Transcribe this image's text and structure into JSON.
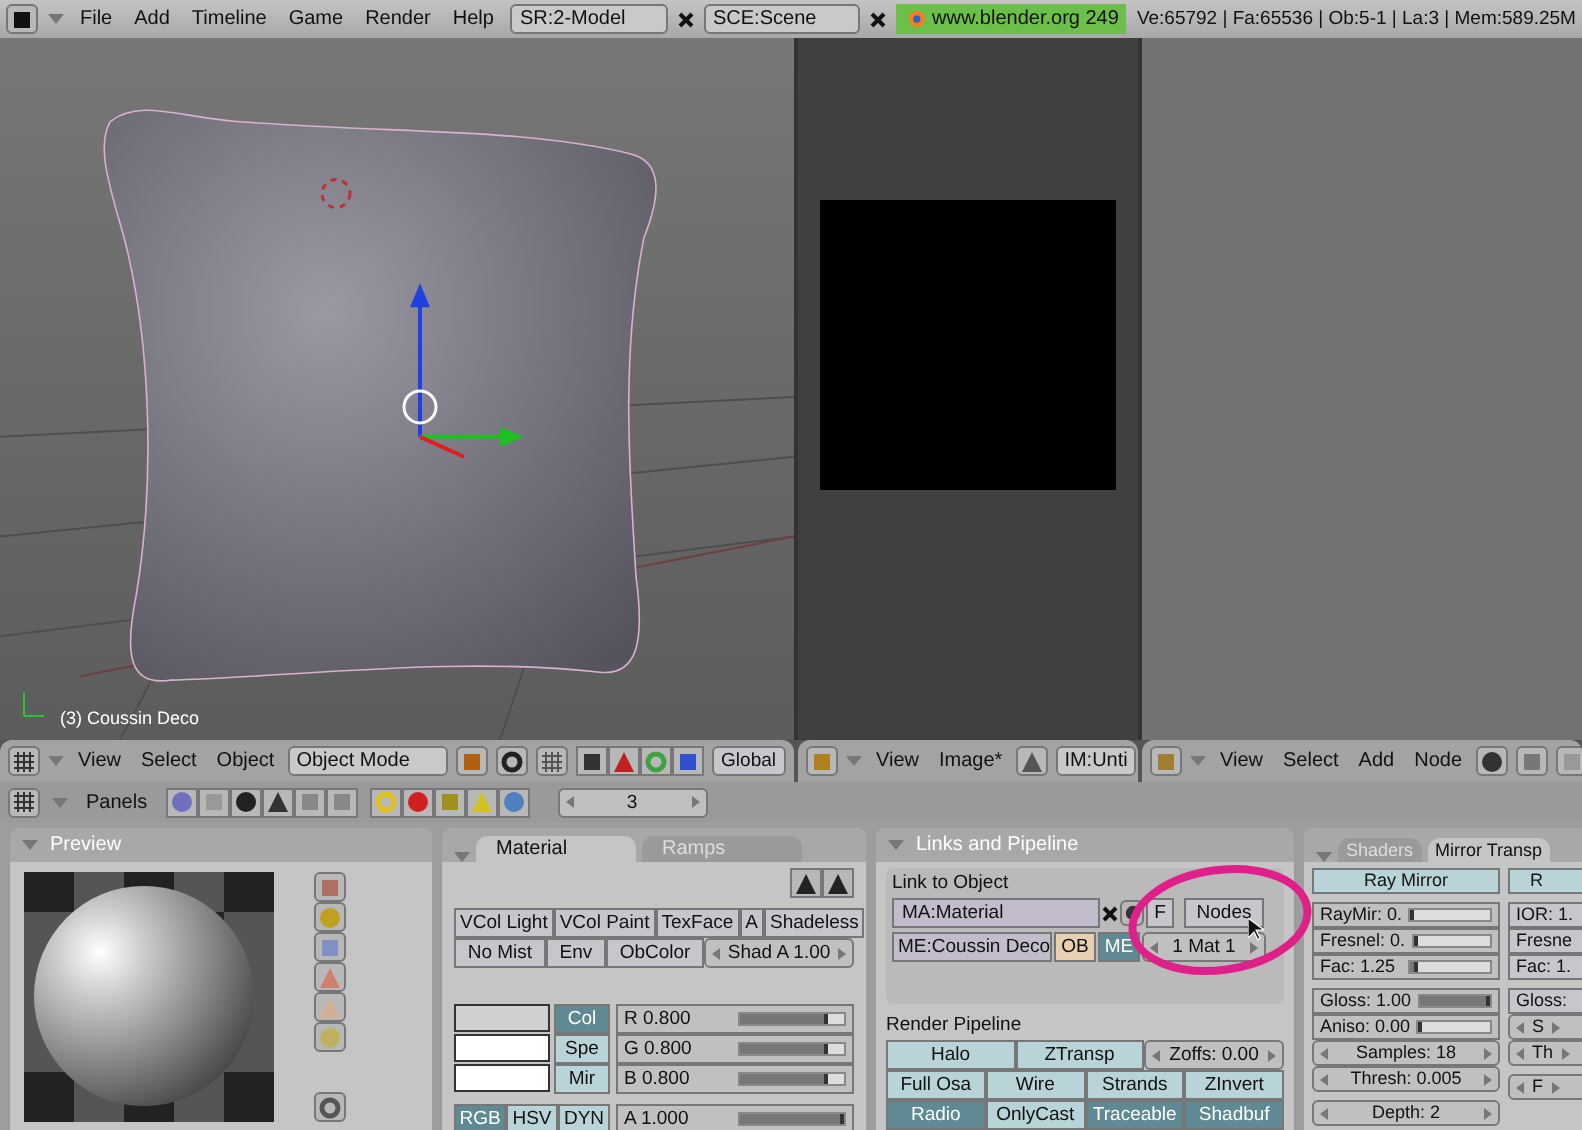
{
  "top_bar": {
    "menus": [
      "File",
      "Add",
      "Timeline",
      "Game",
      "Render",
      "Help"
    ],
    "screen": "SR:2-Model",
    "scene": "SCE:Scene",
    "version": "www.blender.org 249",
    "stats": "Ve:65792 | Fa:65536 | Ob:5-1 | La:3  | Mem:589.25M"
  },
  "viewport": {
    "object_label": "(3) Coussin Deco"
  },
  "view3d_header": {
    "menus": [
      "View",
      "Select",
      "Object"
    ],
    "mode": "Object Mode",
    "orientation": "Global"
  },
  "image_header": {
    "menus": [
      "View",
      "Image*"
    ],
    "image": "IM:Unti"
  },
  "node_header": {
    "menus": [
      "View",
      "Select",
      "Add",
      "Node"
    ]
  },
  "buttons_header": {
    "label": "Panels",
    "frame": "3"
  },
  "preview_panel": {
    "title": "Preview"
  },
  "material_panel": {
    "tabs": [
      {
        "label": "Material",
        "selected": true
      },
      {
        "label": "Ramps",
        "selected": false
      }
    ],
    "toggle_rows": [
      [
        {
          "kind": "toggle",
          "label": "VCol Light",
          "on": false
        },
        {
          "kind": "toggle",
          "label": "VCol Paint",
          "on": false
        },
        {
          "kind": "toggle",
          "label": "TexFace",
          "on": false
        },
        {
          "kind": "toggle",
          "label": "A",
          "on": false
        },
        {
          "kind": "toggle",
          "label": "Shadeless",
          "on": false
        }
      ],
      [
        {
          "kind": "toggle",
          "label": "No Mist",
          "on": false
        },
        {
          "kind": "toggle",
          "label": "Env",
          "on": false
        },
        {
          "kind": "toggle",
          "label": "ObColor",
          "on": false
        },
        {
          "kind": "number",
          "label": "Shad A 1.00"
        }
      ]
    ],
    "swatches": [
      {
        "label": "Col",
        "selected": true,
        "color": "#d0d0d0"
      },
      {
        "label": "Spe",
        "selected": false,
        "color": "#ffffff"
      },
      {
        "label": "Mir",
        "selected": false,
        "color": "#ffffff"
      }
    ],
    "sliders": [
      {
        "label": "R 0.800",
        "level": 0.8
      },
      {
        "label": "G 0.800",
        "level": 0.8
      },
      {
        "label": "B 0.800",
        "level": 0.8
      }
    ],
    "modes": [
      {
        "label": "RGB",
        "selected": true
      },
      {
        "label": "HSV",
        "selected": false
      },
      {
        "label": "DYN",
        "selected": false
      }
    ],
    "alpha": {
      "label": "A 1.000",
      "level": 1
    }
  },
  "links_panel": {
    "title": "Links and Pipeline",
    "link_heading": "Link to Object",
    "material": "MA:Material",
    "f_button": "F",
    "nodes_button": "Nodes",
    "mesh": "ME:Coussin Deco",
    "link_to": [
      {
        "label": "OB",
        "selected": false
      },
      {
        "label": "ME",
        "selected": true
      }
    ],
    "mat_index": "1 Mat 1",
    "pipeline_heading": "Render Pipeline",
    "pipeline": [
      [
        {
          "kind": "toggle",
          "label": "Halo",
          "on": false
        },
        {
          "kind": "toggle",
          "label": "ZTransp",
          "on": false
        },
        {
          "kind": "number",
          "label": "Zoffs: 0.00"
        }
      ],
      [
        {
          "kind": "toggle",
          "label": "Full Osa",
          "on": false
        },
        {
          "kind": "toggle",
          "label": "Wire",
          "on": false
        },
        {
          "kind": "toggle",
          "label": "Strands",
          "on": false
        },
        {
          "kind": "toggle",
          "label": "ZInvert",
          "on": false
        }
      ],
      [
        {
          "kind": "toggle",
          "label": "Radio",
          "on": true
        },
        {
          "kind": "toggle",
          "label": "OnlyCast",
          "on": false
        },
        {
          "kind": "toggle",
          "label": "Traceable",
          "on": true
        },
        {
          "kind": "toggle",
          "label": "Shadbuf",
          "on": true
        }
      ]
    ]
  },
  "shaders_panel": {
    "tabs": [
      {
        "label": "Shaders",
        "selected": false
      },
      {
        "label": "Mirror Transp",
        "selected": true
      }
    ],
    "columns": [
      [
        [
          {
            "kind": "button",
            "label": "Ray Mirror"
          }
        ],
        [
          {
            "kind": "slider",
            "label": "RayMir: 0.",
            "level": 0
          },
          {
            "kind": "slider",
            "label": "Fresnel: 0.",
            "level": 0
          },
          {
            "kind": "slider",
            "label": "Fac: 1.25",
            "level": 0.06
          }
        ],
        [
          {
            "kind": "slider",
            "label": "Gloss: 1.00",
            "level": 1
          },
          {
            "kind": "slider",
            "label": "Aniso: 0.00",
            "level": 0
          },
          {
            "kind": "number",
            "label": "Samples: 18"
          },
          {
            "kind": "number",
            "label": "Thresh: 0.005"
          }
        ],
        [
          {
            "kind": "number",
            "label": "Depth: 2"
          }
        ]
      ],
      [
        [
          {
            "kind": "button",
            "label": "R"
          }
        ],
        [
          {
            "kind": "text",
            "label": "IOR: 1."
          },
          {
            "kind": "text",
            "label": "Fresne"
          },
          {
            "kind": "text",
            "label": "Fac: 1."
          }
        ],
        [
          {
            "kind": "text",
            "label": "Gloss: "
          },
          {
            "kind": "number",
            "label": "S"
          },
          {
            "kind": "number",
            "label": "Th"
          }
        ],
        [
          {
            "kind": "number",
            "label": "F"
          }
        ]
      ]
    ]
  }
}
